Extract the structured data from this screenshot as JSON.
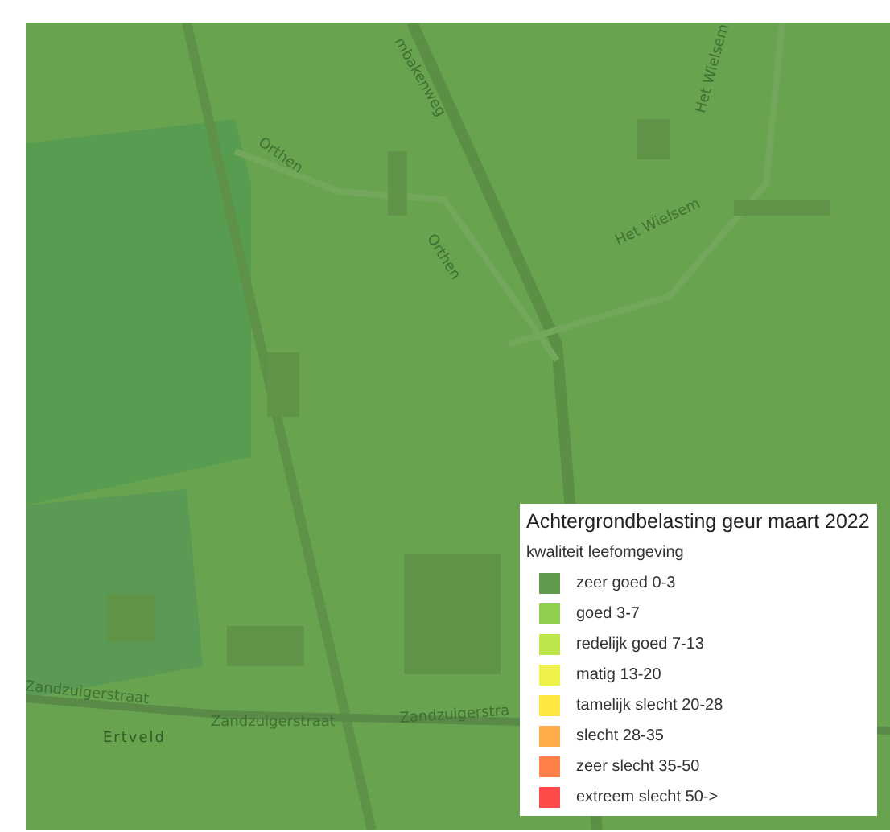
{
  "map": {
    "labels": [
      {
        "text": "Orthen",
        "kind": "street"
      },
      {
        "text": "Orthen",
        "kind": "street"
      },
      {
        "text": "mbakenweg",
        "kind": "street"
      },
      {
        "text": "Het Wielsem",
        "kind": "street"
      },
      {
        "text": "Het Wielsem",
        "kind": "street"
      },
      {
        "text": "Zandzuigerstraat",
        "kind": "street"
      },
      {
        "text": "Zandzuigerstraat",
        "kind": "street"
      },
      {
        "text": "Zandzuigerstra",
        "kind": "street"
      },
      {
        "text": "Ertveld",
        "kind": "area"
      }
    ]
  },
  "legend": {
    "title": "Achtergrondbelasting geur maart 2022",
    "subtitle": "kwaliteit leefomgeving",
    "items": [
      {
        "label": "zeer goed 0-3",
        "color": "#5f9a4e"
      },
      {
        "label": "goed 3-7",
        "color": "#8fd14f"
      },
      {
        "label": "redelijk goed 7-13",
        "color": "#bde64b"
      },
      {
        "label": "matig 13-20",
        "color": "#eef24b"
      },
      {
        "label": "tamelijk slecht 20-28",
        "color": "#ffe640"
      },
      {
        "label": "slecht 28-35",
        "color": "#ffad4a"
      },
      {
        "label": "zeer slecht 35-50",
        "color": "#ff8048"
      },
      {
        "label": "extreem slecht 50->",
        "color": "#ff4a4a"
      }
    ]
  }
}
